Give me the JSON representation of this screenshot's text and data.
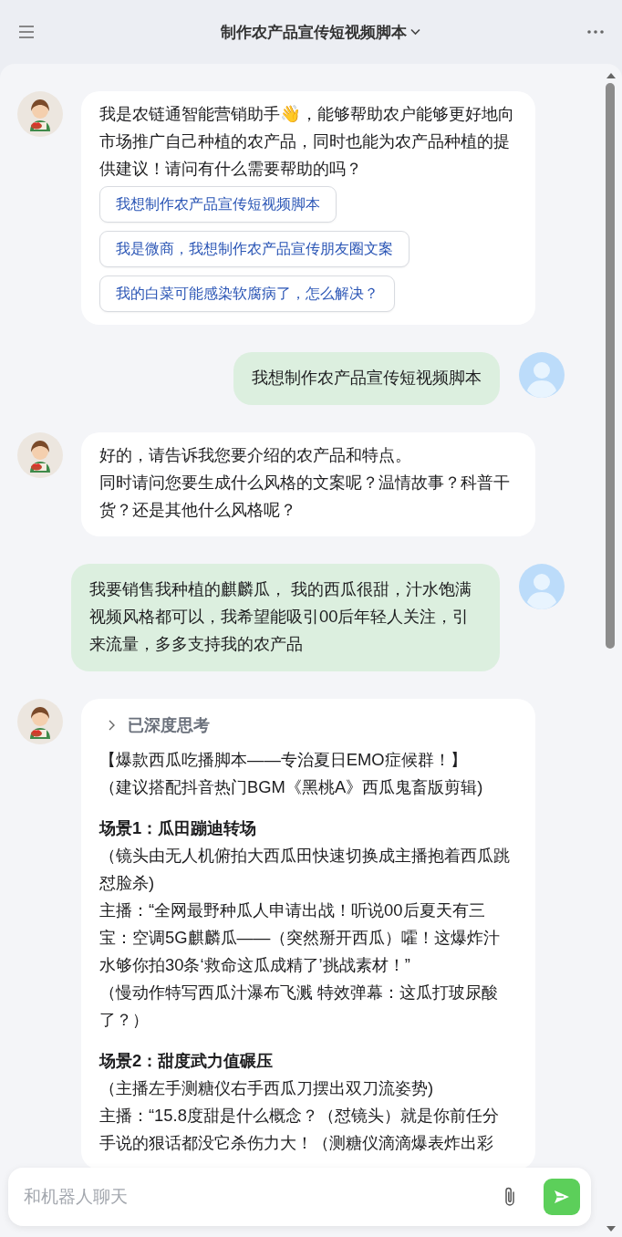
{
  "header": {
    "title": "制作农产品宣传短视频脚本"
  },
  "messages": [
    {
      "kind": "bot",
      "sections": [
        {
          "lines": [
            {
              "kind": "text",
              "text": "我是农链通智能营销助手👋，能够帮助农户能够更好地向市场推广自己种植的农产品，同时也能为农产品种植的提供建议！请问有什么需要帮助的吗？"
            }
          ]
        }
      ],
      "suggestions": [
        "我想制作农产品宣传短视频脚本",
        "我是微商，我想制作农产品宣传朋友圈文案",
        "我的白菜可能感染软腐病了，怎么解决？"
      ]
    },
    {
      "kind": "user",
      "sections": [
        {
          "lines": [
            {
              "kind": "text",
              "text": "我想制作农产品宣传短视频脚本"
            }
          ]
        }
      ]
    },
    {
      "kind": "bot",
      "sections": [
        {
          "lines": [
            {
              "kind": "text",
              "text": "好的，请告诉我您要介绍的农产品和特点。"
            },
            {
              "kind": "text",
              "text": "同时请问您要生成什么风格的文案呢？温情故事？科普干货？还是其他什么风格呢？"
            }
          ]
        }
      ]
    },
    {
      "kind": "user",
      "sections": [
        {
          "lines": [
            {
              "kind": "text",
              "text": "我要销售我种植的麒麟瓜， 我的西瓜很甜，汁水饱满"
            },
            {
              "kind": "text",
              "text": "视频风格都可以，我希望能吸引00后年轻人关注，引来流量，多多支持我的农产品"
            }
          ]
        }
      ]
    },
    {
      "kind": "bot",
      "thinking": {
        "label": "已深度思考",
        "expanded": false
      },
      "sections": [
        {
          "lines": [
            {
              "kind": "text",
              "text": "【爆款西瓜吃播脚本——专治夏日EMO症候群！】"
            },
            {
              "kind": "text",
              "text": "（建议搭配抖音热门BGM《黑桃A》西瓜鬼畜版剪辑)"
            }
          ]
        },
        {
          "lines": [
            {
              "kind": "heading",
              "text": "场景1：瓜田蹦迪转场"
            },
            {
              "kind": "text",
              "text": "（镜头由无人机俯拍大西瓜田快速切换成主播抱着西瓜跳怼脸杀)"
            },
            {
              "kind": "text",
              "text": "主播：“全网最野种瓜人申请出战！听说00后夏天有三宝：空调5G麒麟瓜——（突然掰开西瓜）嚯！这爆炸汁水够你拍30条‘救命这瓜成精了’挑战素材！”"
            },
            {
              "kind": "text",
              "text": "（慢动作特写西瓜汁瀑布飞溅 特效弹幕：这瓜打玻尿酸了？）"
            }
          ]
        },
        {
          "lines": [
            {
              "kind": "heading",
              "text": "场景2：甜度武力值碾压"
            },
            {
              "kind": "text",
              "text": "（主播左手测糖仪右手西瓜刀摆出双刀流姿势)"
            },
            {
              "kind": "text",
              "text": "主播：“15.8度甜是什么概念？（怼镜头）就是你前任分手说的狠话都没它杀伤力大！（测糖仪滴滴爆表炸出彩"
            }
          ]
        }
      ]
    }
  ],
  "input": {
    "placeholder": "和机器人聊天"
  }
}
